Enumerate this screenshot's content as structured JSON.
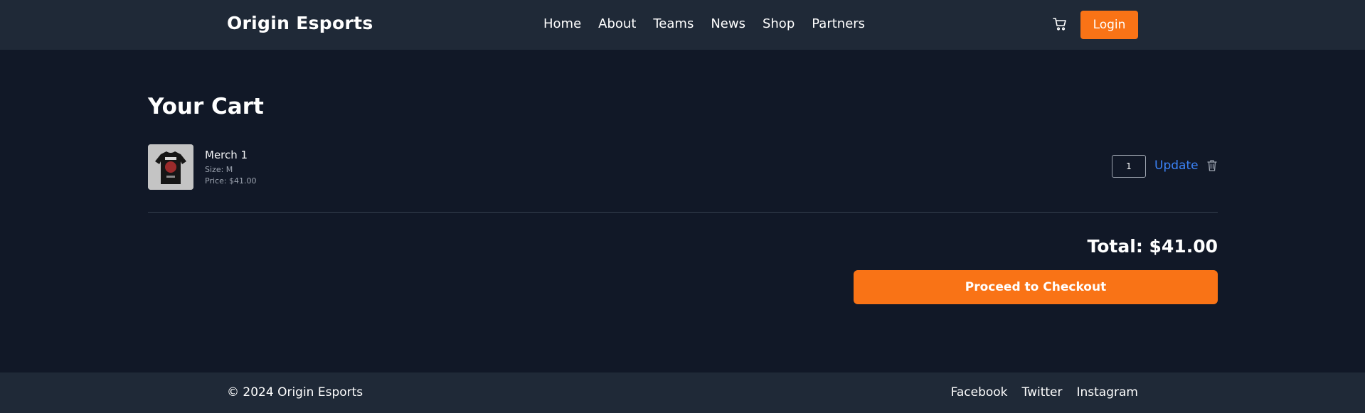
{
  "header": {
    "brand": "Origin Esports",
    "nav": [
      "Home",
      "About",
      "Teams",
      "News",
      "Shop",
      "Partners"
    ],
    "cart_icon": "shopping-cart-icon",
    "login_label": "Login"
  },
  "cart": {
    "title": "Your Cart",
    "items": [
      {
        "name": "Merch 1",
        "size": "Size: M",
        "price": "Price: $41.00",
        "quantity": "1",
        "update_label": "Update",
        "remove_icon": "trash-icon"
      }
    ],
    "total": "Total: $41.00",
    "checkout_label": "Proceed to Checkout"
  },
  "footer": {
    "copyright": "© 2024 Origin Esports",
    "social": [
      "Facebook",
      "Twitter",
      "Instagram"
    ]
  },
  "colors": {
    "accent": "#f97316",
    "link": "#3b82f6",
    "background": "#111827",
    "header_bg": "#1f2937"
  }
}
